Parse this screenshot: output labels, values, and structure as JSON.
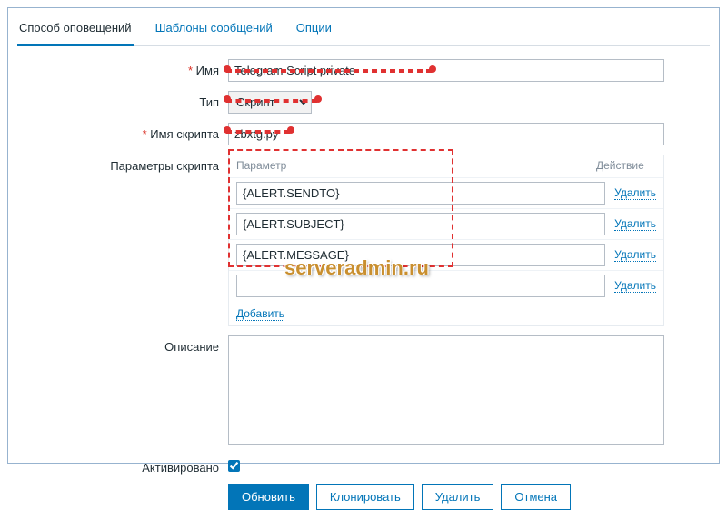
{
  "tabs": {
    "notify": "Способ оповещений",
    "templates": "Шаблоны сообщений",
    "options": "Опции"
  },
  "labels": {
    "name": "Имя",
    "type": "Тип",
    "script_name": "Имя скрипта",
    "script_params": "Параметры скрипта",
    "description": "Описание",
    "enabled": "Активировано"
  },
  "values": {
    "name": "Telegram Script private",
    "type": "Скрипт",
    "script_name": "zbxtg.py",
    "description": "",
    "enabled": true
  },
  "params_table": {
    "header_param": "Параметр",
    "header_action": "Действие",
    "rows": [
      {
        "value": "{ALERT.SENDTO}"
      },
      {
        "value": "{ALERT.SUBJECT}"
      },
      {
        "value": "{ALERT.MESSAGE}"
      },
      {
        "value": ""
      }
    ],
    "delete_label": "Удалить",
    "add_label": "Добавить"
  },
  "buttons": {
    "update": "Обновить",
    "clone": "Клонировать",
    "delete": "Удалить",
    "cancel": "Отмена"
  },
  "watermark": "serveradmin.ru"
}
